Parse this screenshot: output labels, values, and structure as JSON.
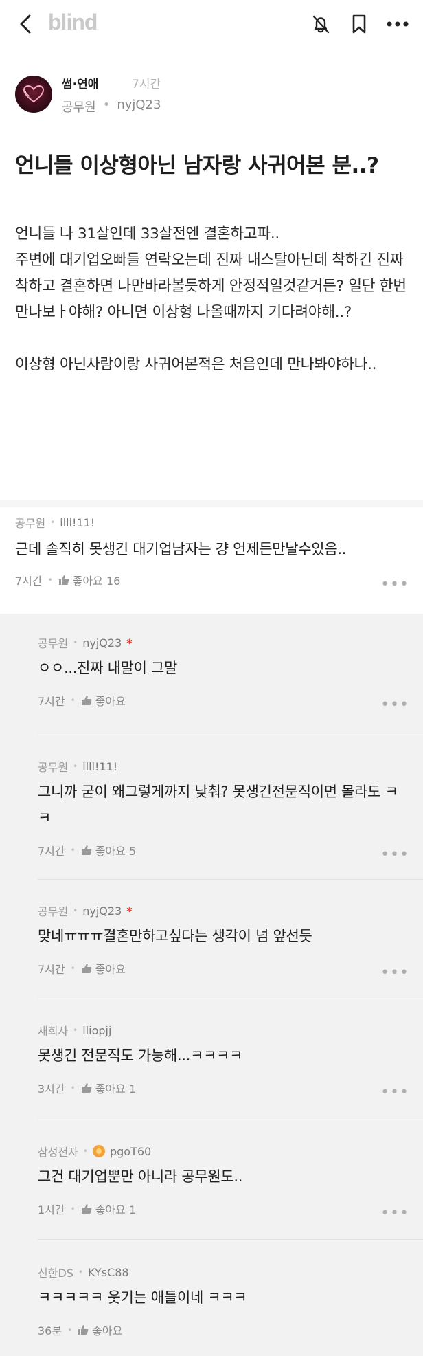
{
  "header": {
    "logo": "blind"
  },
  "post": {
    "channel": "썸·연애",
    "time": "7시간",
    "company": "공무원",
    "author": "nyjQ23",
    "title": "언니들 이상형아닌 남자랑 사귀어본 분..?",
    "body": "언니들 나 31살인데 33살전엔 결혼하고파..\n주변에 대기업오빠들 연락오는데 진짜 내스탈아닌데 착하긴 진짜 착하고 결혼하면 나만바라볼듯하게 안정적일것같거든? 일단 한번 만나보ㅏ야해? 아니면 이상형 나올때까지 기다려야해..?\n\n이상형 아닌사람이랑 사귀어본적은 처음인데 만나봐야하나.."
  },
  "comments": [
    {
      "company": "공무원",
      "nick": "illi!11!",
      "text": "근데 솔직히 못생긴 대기업남자는 걍 언제든만날수있음..",
      "time": "7시간",
      "like_label": "좋아요 16"
    }
  ],
  "replies": [
    {
      "company": "공무원",
      "nick": "nyjQ23",
      "op": true,
      "text": "ㅇㅇ...진짜 내말이 그말",
      "time": "7시간",
      "like_label": "좋아요"
    },
    {
      "company": "공무원",
      "nick": "illi!11!",
      "op": false,
      "text": "그니까 굳이 왜그렇게까지 낮춰? 못생긴전문직이면 몰라도 ㅋㅋ",
      "time": "7시간",
      "like_label": "좋아요 5"
    },
    {
      "company": "공무원",
      "nick": "nyjQ23",
      "op": true,
      "text": "맞네ㅠㅠㅠ결혼만하고싶다는 생각이 넘 앞선듯",
      "time": "7시간",
      "like_label": "좋아요"
    },
    {
      "company": "새회사",
      "nick": "lliopjj",
      "op": false,
      "text": "못생긴 전문직도 가능해...ㅋㅋㅋㅋ",
      "time": "3시간",
      "like_label": "좋아요 1"
    },
    {
      "company": "삼성전자",
      "nick": "pgoT60",
      "op": false,
      "text": "그건 대기업뿐만 아니라 공무원도..",
      "time": "1시간",
      "like_label": "좋아요 1"
    },
    {
      "company": "신한DS",
      "nick": "KYsC88",
      "op": false,
      "text": "ㅋㅋㅋㅋㅋ 웃기는 애들이네 ㅋㅋㅋ",
      "time": "36분",
      "like_label": "좋아요"
    }
  ],
  "op_mark": "*",
  "colors": {
    "accent_red": "#e0443f",
    "bg_gray": "#f2f2f2",
    "logo_gray": "#c9c9c9"
  }
}
